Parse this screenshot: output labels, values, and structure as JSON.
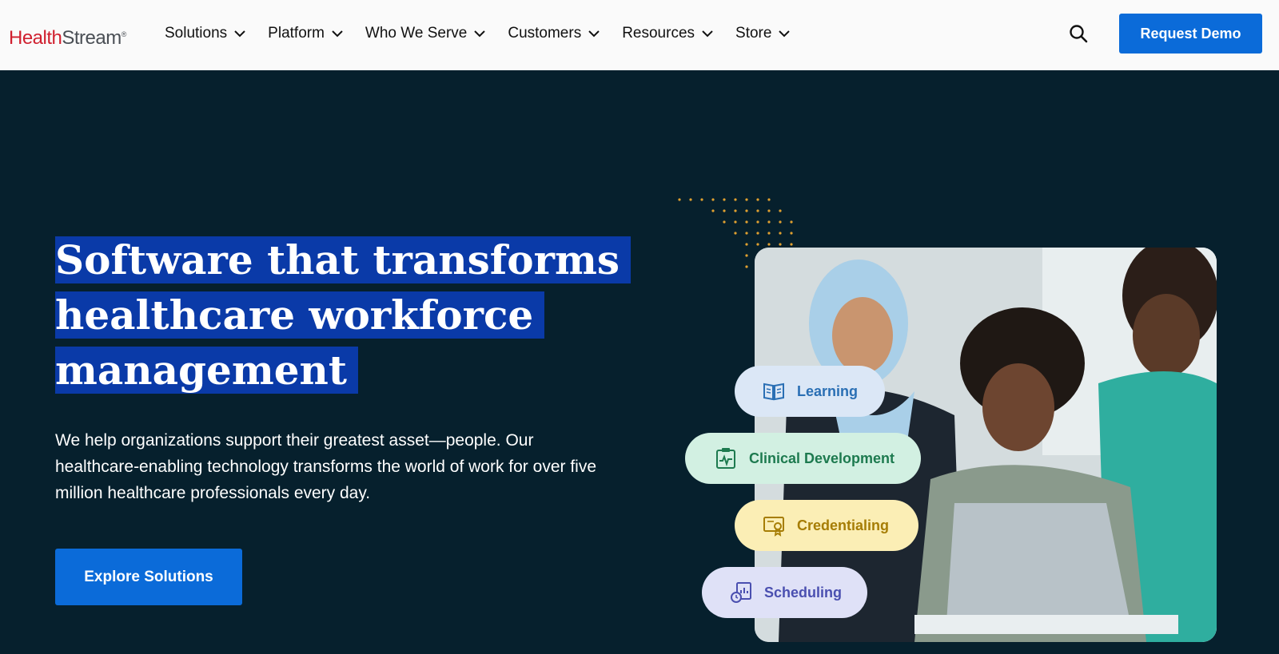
{
  "header": {
    "logo": {
      "part1": "Health",
      "part2": "Stream",
      "mark": "®"
    },
    "nav": [
      {
        "label": "Solutions",
        "icon": "chevron-down-icon"
      },
      {
        "label": "Platform",
        "icon": "chevron-down-icon"
      },
      {
        "label": "Who We Serve",
        "icon": "chevron-down-icon"
      },
      {
        "label": "Customers",
        "icon": "chevron-down-icon"
      },
      {
        "label": "Resources",
        "icon": "chevron-down-icon"
      },
      {
        "label": "Store",
        "icon": "chevron-down-icon"
      }
    ],
    "search_icon": "search-icon",
    "demo_label": "Request Demo"
  },
  "hero": {
    "headline": [
      "Software that transforms",
      "healthcare workforce",
      "management"
    ],
    "subtext": "We help organizations support their greatest asset—people. Our healthcare-enabling technology transforms the world of work for over five million healthcare professionals every day.",
    "cta_label": "Explore Solutions"
  },
  "features": [
    {
      "label": "Learning",
      "icon": "book-icon",
      "color": "#2a6fb4"
    },
    {
      "label": "Clinical Development",
      "icon": "clipboard-icon",
      "color": "#1d7a4f"
    },
    {
      "label": "Credentialing",
      "icon": "certificate-icon",
      "color": "#a67d05"
    },
    {
      "label": "Scheduling",
      "icon": "schedule-icon",
      "color": "#4a4fb0"
    }
  ],
  "colors": {
    "accent": "#0b6bd9",
    "background": "#06202d",
    "highlight": "#0a3aa8",
    "logo_red": "#d0202f",
    "dots": "#e0a030"
  }
}
